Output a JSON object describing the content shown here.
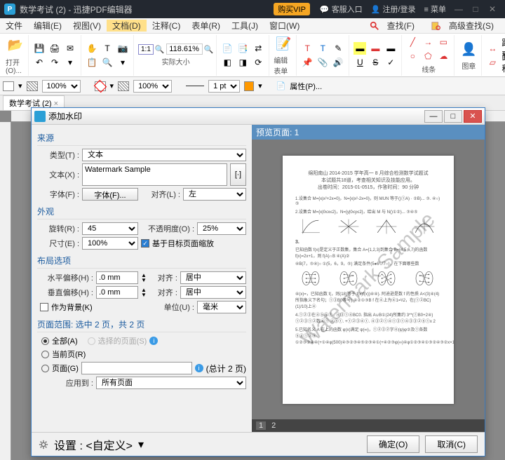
{
  "app": {
    "title": "数学考试 (2) - 迅捷PDF编辑器",
    "logo": "P"
  },
  "titlebar": {
    "vip": "购买VIP",
    "support": "客服入口",
    "login": "注册/登录",
    "menu": "菜单"
  },
  "menu": {
    "file": "文件",
    "edit": "编辑(E)",
    "view": "视图(V)",
    "doc": "文档(D)",
    "comment": "注释(C)",
    "form": "表单(R)",
    "tool": "工具(J)",
    "window": "窗口(W)",
    "find": "查找(F)",
    "advfind": "高级查找(S)"
  },
  "ribbon": {
    "open": "打开(O)...",
    "zoom": "118.61%",
    "actual": "实际大小",
    "editform": "编辑表单",
    "line": "线条",
    "image": "图章",
    "dist": "距离",
    "area": "面积"
  },
  "propbar": {
    "pct1": "100%",
    "pct2": "100%",
    "pt": "1 pt",
    "props": "属性(P)..."
  },
  "tab": {
    "name": "数学考试 (2)"
  },
  "dialog": {
    "title": "添加水印",
    "source": "来源",
    "type_lbl": "类型(T) :",
    "type_val": "文本",
    "text_lbl": "文本(X) :",
    "text_val": "Watermark Sample",
    "font_lbl": "字体(F) :",
    "font_btn": "字体(F)...",
    "align_lbl": "对齐(L) :",
    "align_val": "左",
    "appearance": "外观",
    "rot_lbl": "旋转(R) :",
    "rot_val": "45",
    "opac_lbl": "不透明度(O) :",
    "opac_val": "25%",
    "size_lbl": "尺寸(E) :",
    "size_val": "100%",
    "scale_chk": "基于目标页面缩放",
    "layout": "布局选项",
    "hoff_lbl": "水平偏移(H) :",
    "hoff_val": ".0 mm",
    "voff_lbl": "垂直偏移(H) :",
    "voff_val": ".0 mm",
    "halign_lbl": "对齐 :",
    "halign_val": "居中",
    "valign_lbl": "对齐 :",
    "valign_val": "居中",
    "bg_chk": "作为背景(K)",
    "unit_lbl": "单位(U) :",
    "unit_val": "毫米",
    "range_title": "页面范围: 选中 2 页，共 2 页",
    "all": "全部(A)",
    "current": "当前页(R)",
    "pages": "页面(G)",
    "selected": "选择的页面(S)",
    "total": "(总计 2 页)",
    "apply_lbl": "应用到 :",
    "apply_val": "所有页面",
    "preview": "预览页面:  1",
    "page1": "1",
    "page2": "2",
    "settings": "设置 : <自定义>",
    "ok": "确定(O)",
    "cancel": "取消(C)",
    "watermark_preview": "Watermark Sample"
  }
}
